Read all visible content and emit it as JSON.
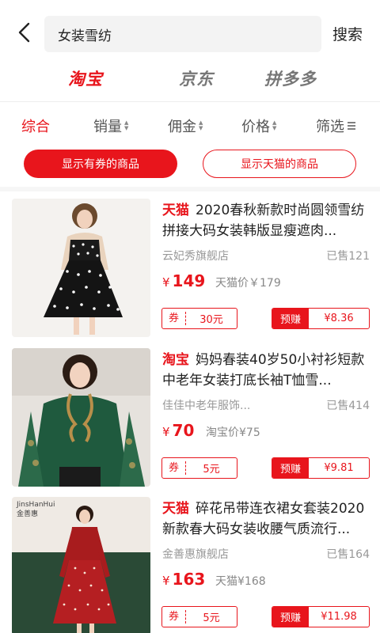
{
  "search": {
    "query": "女装雪纺",
    "button": "搜索"
  },
  "platforms": [
    "淘宝",
    "京东",
    "拼多多"
  ],
  "sort": [
    "综合",
    "销量",
    "佣金",
    "价格",
    "筛选"
  ],
  "filters": {
    "coupon": "显示有券的商品",
    "tmall": "显示天猫的商品"
  },
  "products": [
    {
      "tag": "天猫",
      "title": "2020春秋新款时尚圆领雪纺拼接大码女装韩版显瘦遮肉...",
      "shop": "云妃秀旗舰店",
      "sold": "已售121",
      "price_symbol": "¥",
      "price": "149",
      "orig": "天猫价￥179",
      "coupon_label": "券",
      "coupon_value": "30元",
      "earn_label": "预赚",
      "earn_value": "¥8.36"
    },
    {
      "tag": "淘宝",
      "title": "妈妈春装40岁50小衬衫短款中老年女装打底长袖T恤雪...",
      "shop": "佳佳中老年服饰...",
      "sold": "已售414",
      "price_symbol": "¥",
      "price": "70",
      "orig": "淘宝价¥75",
      "coupon_label": "券",
      "coupon_value": "5元",
      "earn_label": "预赚",
      "earn_value": "¥9.81"
    },
    {
      "tag": "天猫",
      "title": "碎花吊带连衣裙女套装2020新款春大码女装收腰气质流行...",
      "shop": "金善惠旗舰店",
      "sold": "已售164",
      "price_symbol": "¥",
      "price": "163",
      "orig": "天猫¥168",
      "coupon_label": "券",
      "coupon_value": "5元",
      "earn_label": "预赚",
      "earn_value": "¥11.98"
    }
  ],
  "image_text": {
    "brand_en": "JinsHanHui",
    "brand_cn": "金善惠"
  },
  "colors": {
    "accent": "#e8151c"
  }
}
